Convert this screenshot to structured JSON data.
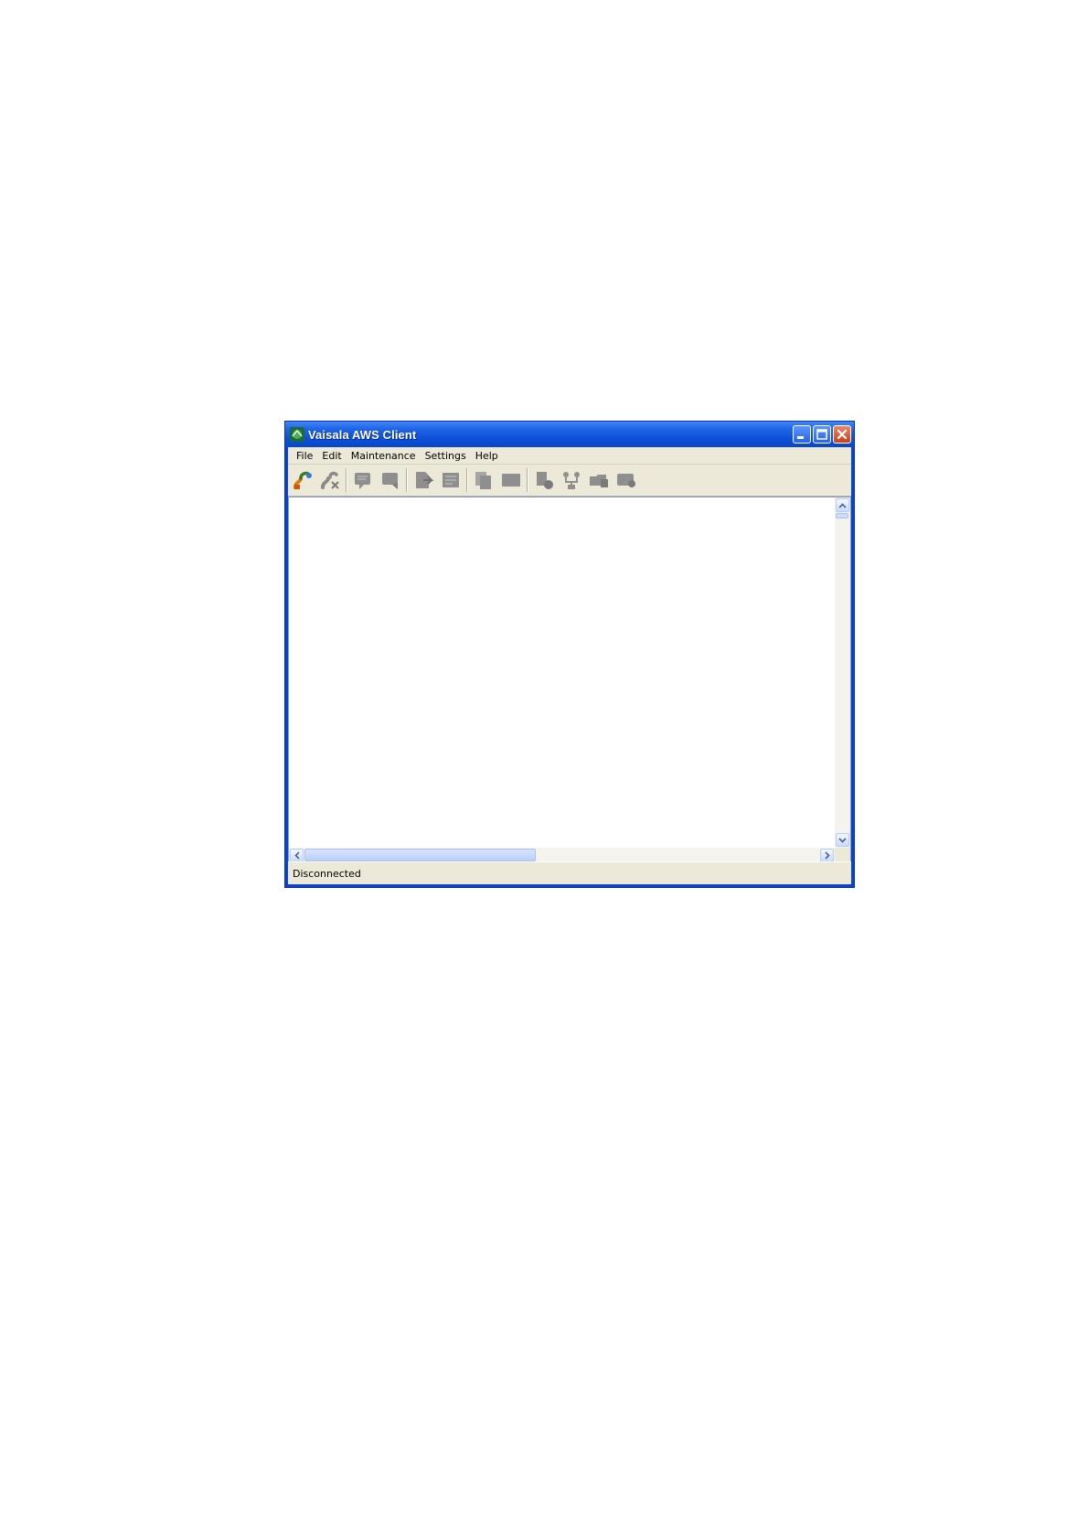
{
  "window": {
    "title": "Vaisala AWS Client",
    "accent": "#0a47c8"
  },
  "menu": {
    "items": [
      "File",
      "Edit",
      "Maintenance",
      "Settings",
      "Help"
    ]
  },
  "toolbar": {
    "buttons": [
      {
        "icon": "connect-icon",
        "enabled": true
      },
      {
        "icon": "disconnect-icon",
        "enabled": false
      },
      {
        "icon": "message-icon",
        "enabled": false
      },
      {
        "icon": "message-edit-icon",
        "enabled": false
      },
      {
        "icon": "document-arrow-icon",
        "enabled": false
      },
      {
        "icon": "document-list-icon",
        "enabled": false
      },
      {
        "icon": "copy-icon",
        "enabled": false
      },
      {
        "icon": "screen-icon",
        "enabled": false
      },
      {
        "icon": "database-icon",
        "enabled": false
      },
      {
        "icon": "network-icon",
        "enabled": false
      },
      {
        "icon": "folder-icon",
        "enabled": false
      },
      {
        "icon": "terminal-icon",
        "enabled": false
      }
    ]
  },
  "scroll": {
    "horizontal_thumb_fraction": 0.45
  },
  "status": {
    "text": "Disconnected"
  }
}
